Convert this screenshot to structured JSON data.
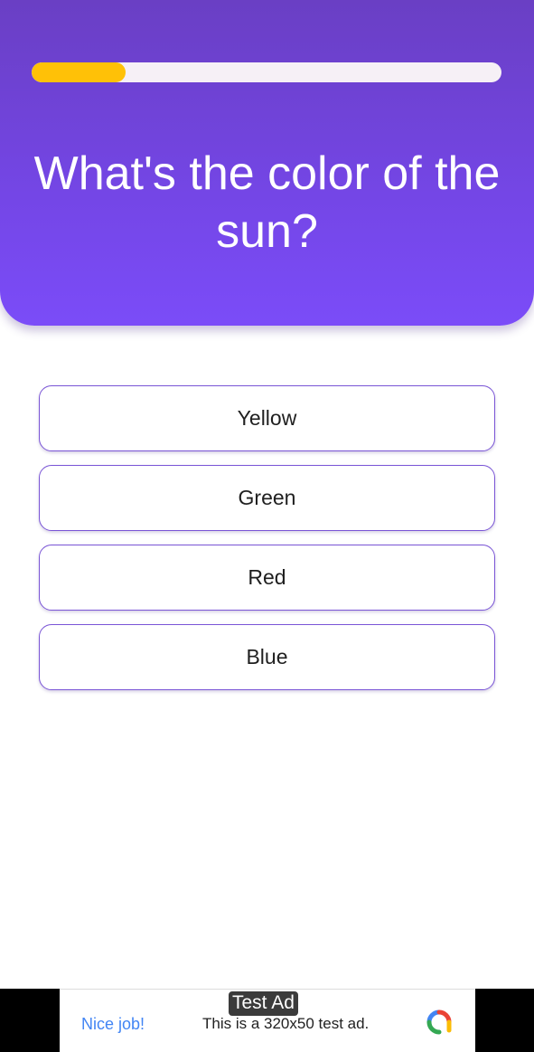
{
  "quiz": {
    "progress": 0.2,
    "question": "What's the color of the sun?",
    "options": [
      "Yellow",
      "Green",
      "Red",
      "Blue"
    ]
  },
  "ad": {
    "tag": "Test Ad",
    "cta": "Nice job!",
    "text": "This is a 320x50 test ad.",
    "logo_icon": "admob-logo-icon"
  },
  "colors": {
    "header_top": "#6a3fc4",
    "header_bottom": "#7b4cf8",
    "progress_fill": "#ffc107",
    "progress_track": "#f6f0f6",
    "option_border": "#7a55d6",
    "ad_cta": "#4285f4"
  }
}
